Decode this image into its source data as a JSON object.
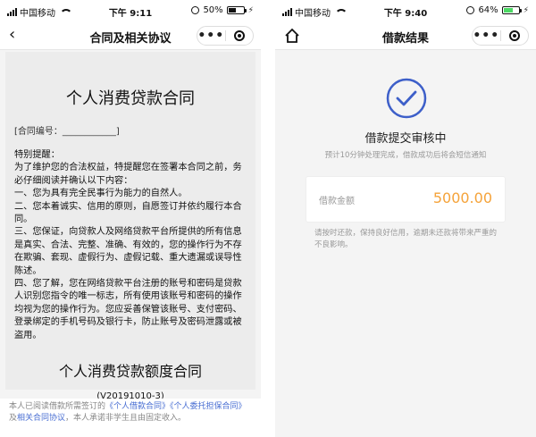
{
  "left": {
    "status": {
      "carrier": "中国移动",
      "time": "下午 9:11",
      "battery": "50%"
    },
    "nav": {
      "title": "合同及相关协议",
      "back_glyph": "‹",
      "more_glyph": "•••"
    },
    "doc": {
      "title": "个人消费贷款合同",
      "contract_no": "[合同编号：____________]",
      "body_lines": [
        "特别提醒：",
        "为了维护您的合法权益，特提醒您在签署本合同之前，务必仔细阅读并确认以下内容：",
        "一、您为具有完全民事行为能力的自然人。",
        "二、您本着诚实、信用的原则，自愿签订并依约履行本合同。",
        "三、您保证，向贷款人及网络贷款平台所提供的所有信息是真实、合法、完整、准确、有效的，您的操作行为不存在欺骗、套现、虚假行为、虚假记载、重大遗漏或误导性陈述。",
        "四、您了解，您在网络贷款平台注册的账号和密码是贷款人识别您指令的唯一标志，所有使用该账号和密码的操作均视为您的操作行为。您应妥善保管该账号、支付密码、登录绑定的手机号码及银行卡，防止账号及密码泄露或被盗用。"
      ],
      "title2": "个人消费贷款额度合同",
      "version": "(V20191010-3)"
    },
    "footer": {
      "prefix": "本人已阅读借款所需签订的",
      "link1": "《个人借款合同》",
      "link2": "《个人委托担保合同》",
      "and": "及",
      "link3": "相关合同协议",
      "suffix": "，本人承诺非学生且由固定收入。"
    }
  },
  "right": {
    "status": {
      "carrier": "中国移动",
      "time": "下午 9:40",
      "battery": "64%"
    },
    "nav": {
      "title": "借款结果",
      "more_glyph": "•••"
    },
    "result": {
      "status_title": "借款提交审核中",
      "tip": "预计10分钟处理完成，借款成功后将会短信通知",
      "amount_label": "借款金额",
      "amount_value": "5000.00",
      "notice": "请按时还款，保持良好信用，逾期未还款将带来严重的不良影响。"
    }
  },
  "colors": {
    "accent_blue": "#3d5fc9",
    "amount_orange": "#f5a33a",
    "link_blue": "#4a6fd3"
  }
}
